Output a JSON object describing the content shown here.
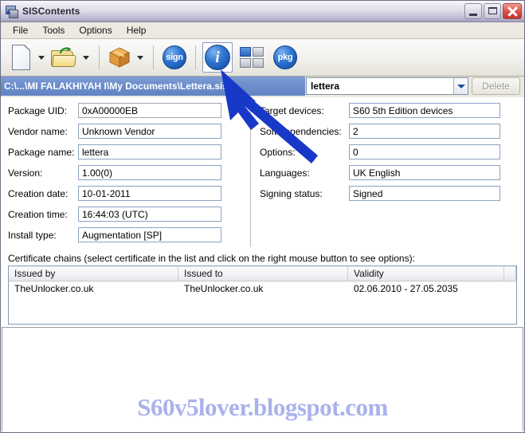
{
  "window": {
    "title": "SISContents",
    "app_icon": "sis-app-icon",
    "buttons": {
      "minimize": "minimize-button",
      "maximize": "maximize-button",
      "close": "close-button"
    }
  },
  "menubar": {
    "items": [
      {
        "label": "File"
      },
      {
        "label": "Tools"
      },
      {
        "label": "Options"
      },
      {
        "label": "Help"
      }
    ]
  },
  "toolbar": {
    "items": [
      {
        "name": "new-document-button",
        "icon": "new-document-icon",
        "has_dropdown": true
      },
      {
        "name": "open-folder-button",
        "icon": "open-folder-icon",
        "has_dropdown": true
      },
      {
        "name": "package-button",
        "icon": "package-box-icon",
        "has_dropdown": true
      },
      {
        "name": "sign-button",
        "icon": "sign-icon",
        "label": "sign"
      },
      {
        "name": "info-button",
        "icon": "info-icon",
        "label": "i",
        "selected": true
      },
      {
        "name": "contents-grid-button",
        "icon": "grid-squares-icon"
      },
      {
        "name": "pkg-button",
        "icon": "pkg-icon",
        "label": "pkg"
      }
    ]
  },
  "pathbar": {
    "path": "C:\\...\\MI FALAKHIYAH I\\My Documents\\Lettera.sis",
    "combo_value": "lettera",
    "combo_icon": "chevron-down-icon",
    "delete_label": "Delete",
    "delete_enabled": false
  },
  "form": {
    "left": [
      {
        "label": "Package UID:",
        "value": "0xA00000EB",
        "style": "grey"
      },
      {
        "label": "Vendor name:",
        "value": "Unknown Vendor",
        "style": "blue"
      },
      {
        "label": "Package name:",
        "value": "lettera",
        "style": "blue"
      },
      {
        "label": "Version:",
        "value": "1.00(0)",
        "style": "blue"
      },
      {
        "label": "Creation date:",
        "value": "10-01-2011",
        "style": "blue"
      },
      {
        "label": "Creation time:",
        "value": "16:44:03 (UTC)",
        "style": "blue"
      },
      {
        "label": "Install type:",
        "value": "Augmentation [SP]",
        "style": "blue"
      }
    ],
    "right": [
      {
        "label": "Target devices:",
        "value": "S60 5th Edition devices"
      },
      {
        "label": "Soft dependencies:",
        "value": "2"
      },
      {
        "label": "Options:",
        "value": "0"
      },
      {
        "label": "Languages:",
        "value": "UK English"
      },
      {
        "label": "Signing status:",
        "value": "Signed"
      }
    ]
  },
  "certificates": {
    "caption": "Certificate chains (select certificate in the list and click on the right mouse button to see options):",
    "columns": [
      "Issued by",
      "Issued to",
      "Validity"
    ],
    "rows": [
      {
        "issued_by": "TheUnlocker.co.uk",
        "issued_to": "TheUnlocker.co.uk",
        "validity": "02.06.2010 - 27.05.2035"
      }
    ]
  },
  "watermark": {
    "text": "S60v5lover.blogspot.com",
    "color": "#a9b2ec"
  },
  "annotation": {
    "arrow": "blue-pointer-arrow",
    "color": "#1838c8"
  }
}
